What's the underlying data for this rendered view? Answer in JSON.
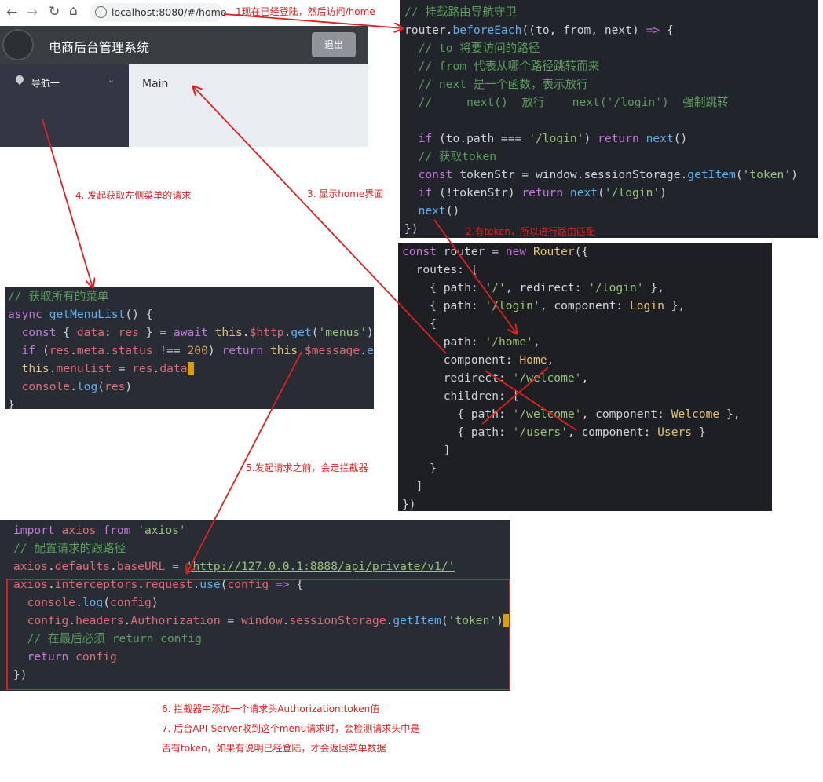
{
  "browser": {
    "url": "localhost:8080/#/home"
  },
  "app": {
    "title": "电商后台管理系统",
    "logout_label": "退出",
    "nav_item": "导航一",
    "main_label": "Main"
  },
  "notes": {
    "n1": "1现在已经登陆，然后访问/home",
    "n2": "2.有token，所以进行路由匹配",
    "n3": "3. 显示home界面",
    "n4": "4. 发起获取左侧菜单的请求",
    "n5": "5.发起请求之前，会走拦截器",
    "n6": "6. 拦截器中添加一个请求头Authorization:token值",
    "n7a": "7. 后台API-Server收到这个menu请求时，会检测请求头中是",
    "n7b": "否有token，如果有说明已经登陆，才会返回菜单数据"
  },
  "colors": {
    "arrow": "#e02020",
    "code_bg": "#21252b",
    "header_bg": "#373d41",
    "aside_bg": "#333744",
    "main_bg": "#eaedf1",
    "logout_bg": "#909399"
  }
}
